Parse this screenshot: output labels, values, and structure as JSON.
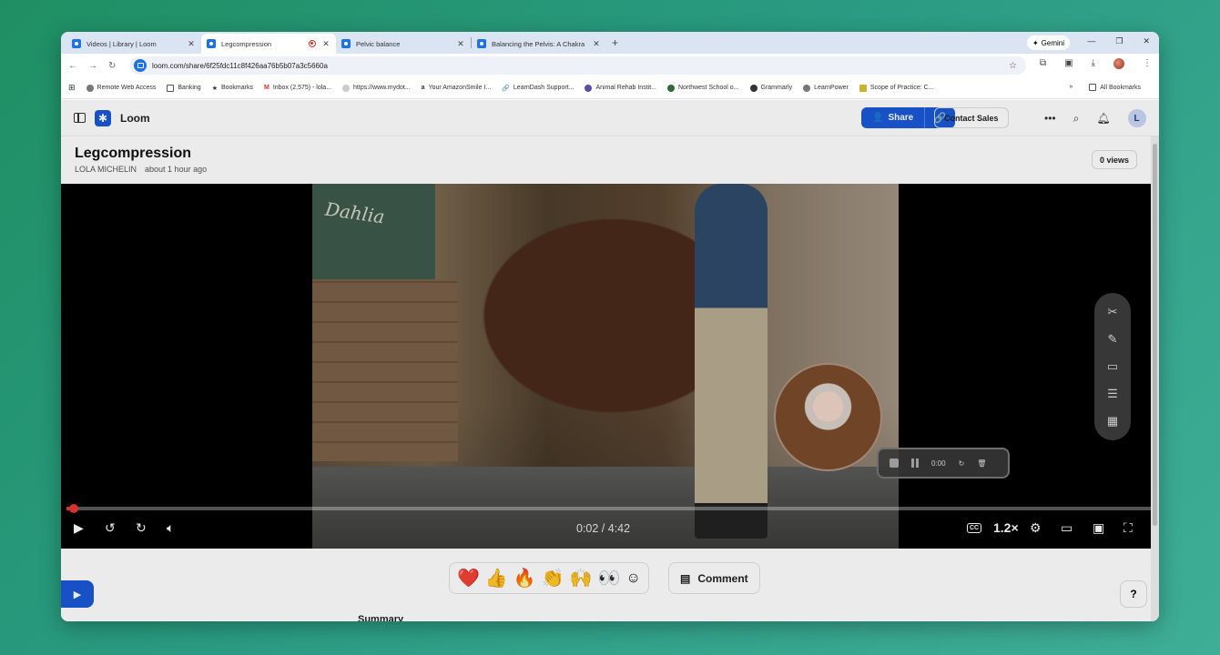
{
  "browser": {
    "tabs": [
      {
        "title": "Videos | Library | Loom",
        "active": false
      },
      {
        "title": "Legcompression",
        "active": true,
        "recording": true
      },
      {
        "title": "Pelvic balance",
        "active": false
      },
      {
        "title": "Balancing the Pelvis: A Chakra",
        "active": false
      }
    ],
    "gemini_label": "Gemini",
    "url": "loom.com/share/6f25fdc11c8f426aa76b5b07a3c5660a",
    "bookmarks": [
      "Remote Web Access",
      "Banking",
      "Bookmarks",
      "Inbox (2,575) - lola...",
      "https://www.mydot...",
      "Your AmazonSmile I...",
      "LearnDash Support...",
      "Animal Rehab Instit...",
      "Northwest School o...",
      "Grammarly",
      "LearnPower",
      "Scope of Practice: C..."
    ],
    "all_bookmarks_label": "All Bookmarks"
  },
  "loom": {
    "app_name": "Loom",
    "share_label": "Share",
    "contact_sales_label": "Contact Sales",
    "user_initial": "L",
    "video_title": "Legcompression",
    "author": "LOLA MICHELIN",
    "uploaded": "about 1 hour ago",
    "views": "0 views",
    "board_text": "Dahlia",
    "recorder_time": "0:00",
    "time_display": "0:02 / 4:42",
    "progress_fraction": 0.007,
    "speed": "1.2×",
    "cc_label": "CC",
    "reactions": [
      "❤️",
      "👍",
      "🔥",
      "👏",
      "🙌",
      "👀"
    ],
    "comment_label": "Comment",
    "summary_label": "Summary",
    "help_label": "?"
  }
}
